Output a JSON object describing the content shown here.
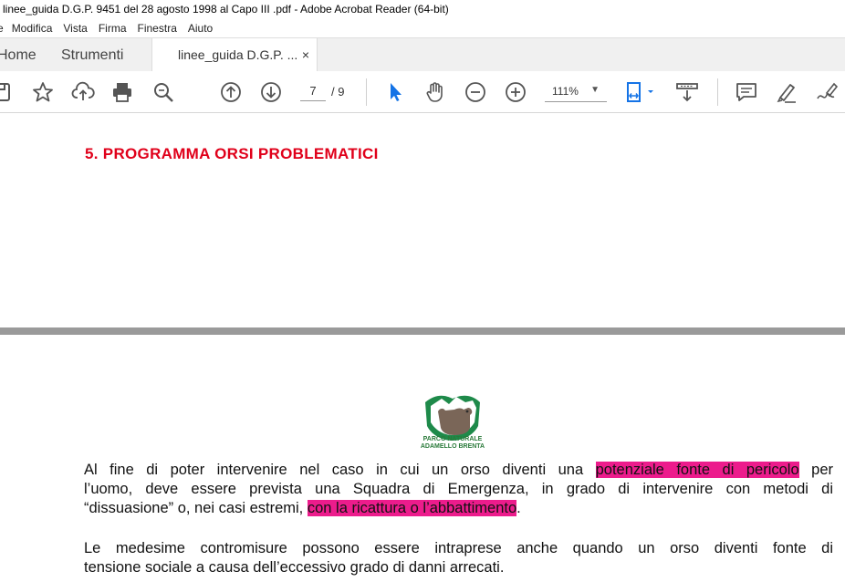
{
  "window": {
    "title": "linee_guida D.G.P. 9451 del 28 agosto 1998 al Capo III .pdf - Adobe Acrobat Reader (64-bit)"
  },
  "menu": [
    "e",
    "Modifica",
    "Vista",
    "Firma",
    "Finestra",
    "Aiuto"
  ],
  "tabs": {
    "home": "Home",
    "tools": "Strumenti",
    "document": "linee_guida D.G.P. ...",
    "close": "×"
  },
  "toolbar": {
    "page_current": "7",
    "page_total": "/ 9",
    "zoom": "111%",
    "icons": [
      "save-icon",
      "star-icon",
      "cloud-upload-icon",
      "print-icon",
      "search-icon",
      "page-up-icon",
      "page-down-icon",
      "select-cursor-icon",
      "hand-icon",
      "zoom-out-icon",
      "zoom-in-icon",
      "fit-page-icon",
      "scroll-mode-icon",
      "comment-icon",
      "highlight-icon",
      "sign-icon"
    ],
    "accent_color": "#1473e6"
  },
  "document": {
    "heading": "5. PROGRAMMA ORSI PROBLEMATICI",
    "heading_color": "#e0001a",
    "logo_text": [
      "PARCO NATURALE",
      "ADAMELLO BRENTA"
    ],
    "highlight_color": "#ec1c8c",
    "p1": {
      "l1_a": "Al fine di poter intervenire nel caso in cui un orso diventi una ",
      "l1_hl": "potenziale fonte di pericolo",
      "l1_b": " per",
      "l2": "l’uomo, deve essere prevista una Squadra di Emergenza, in grado di intervenire con metodi di",
      "l3_a": "“dissuasione” o, nei casi estremi, ",
      "l3_hl": "con la ricattura o l’abbattimento",
      "l3_b": "."
    },
    "p2": {
      "l1": "Le medesime contromisure possono essere intraprese anche quando un orso diventi fonte di",
      "l2": "tensione sociale a causa dell’eccessivo grado di danni arrecati."
    }
  }
}
